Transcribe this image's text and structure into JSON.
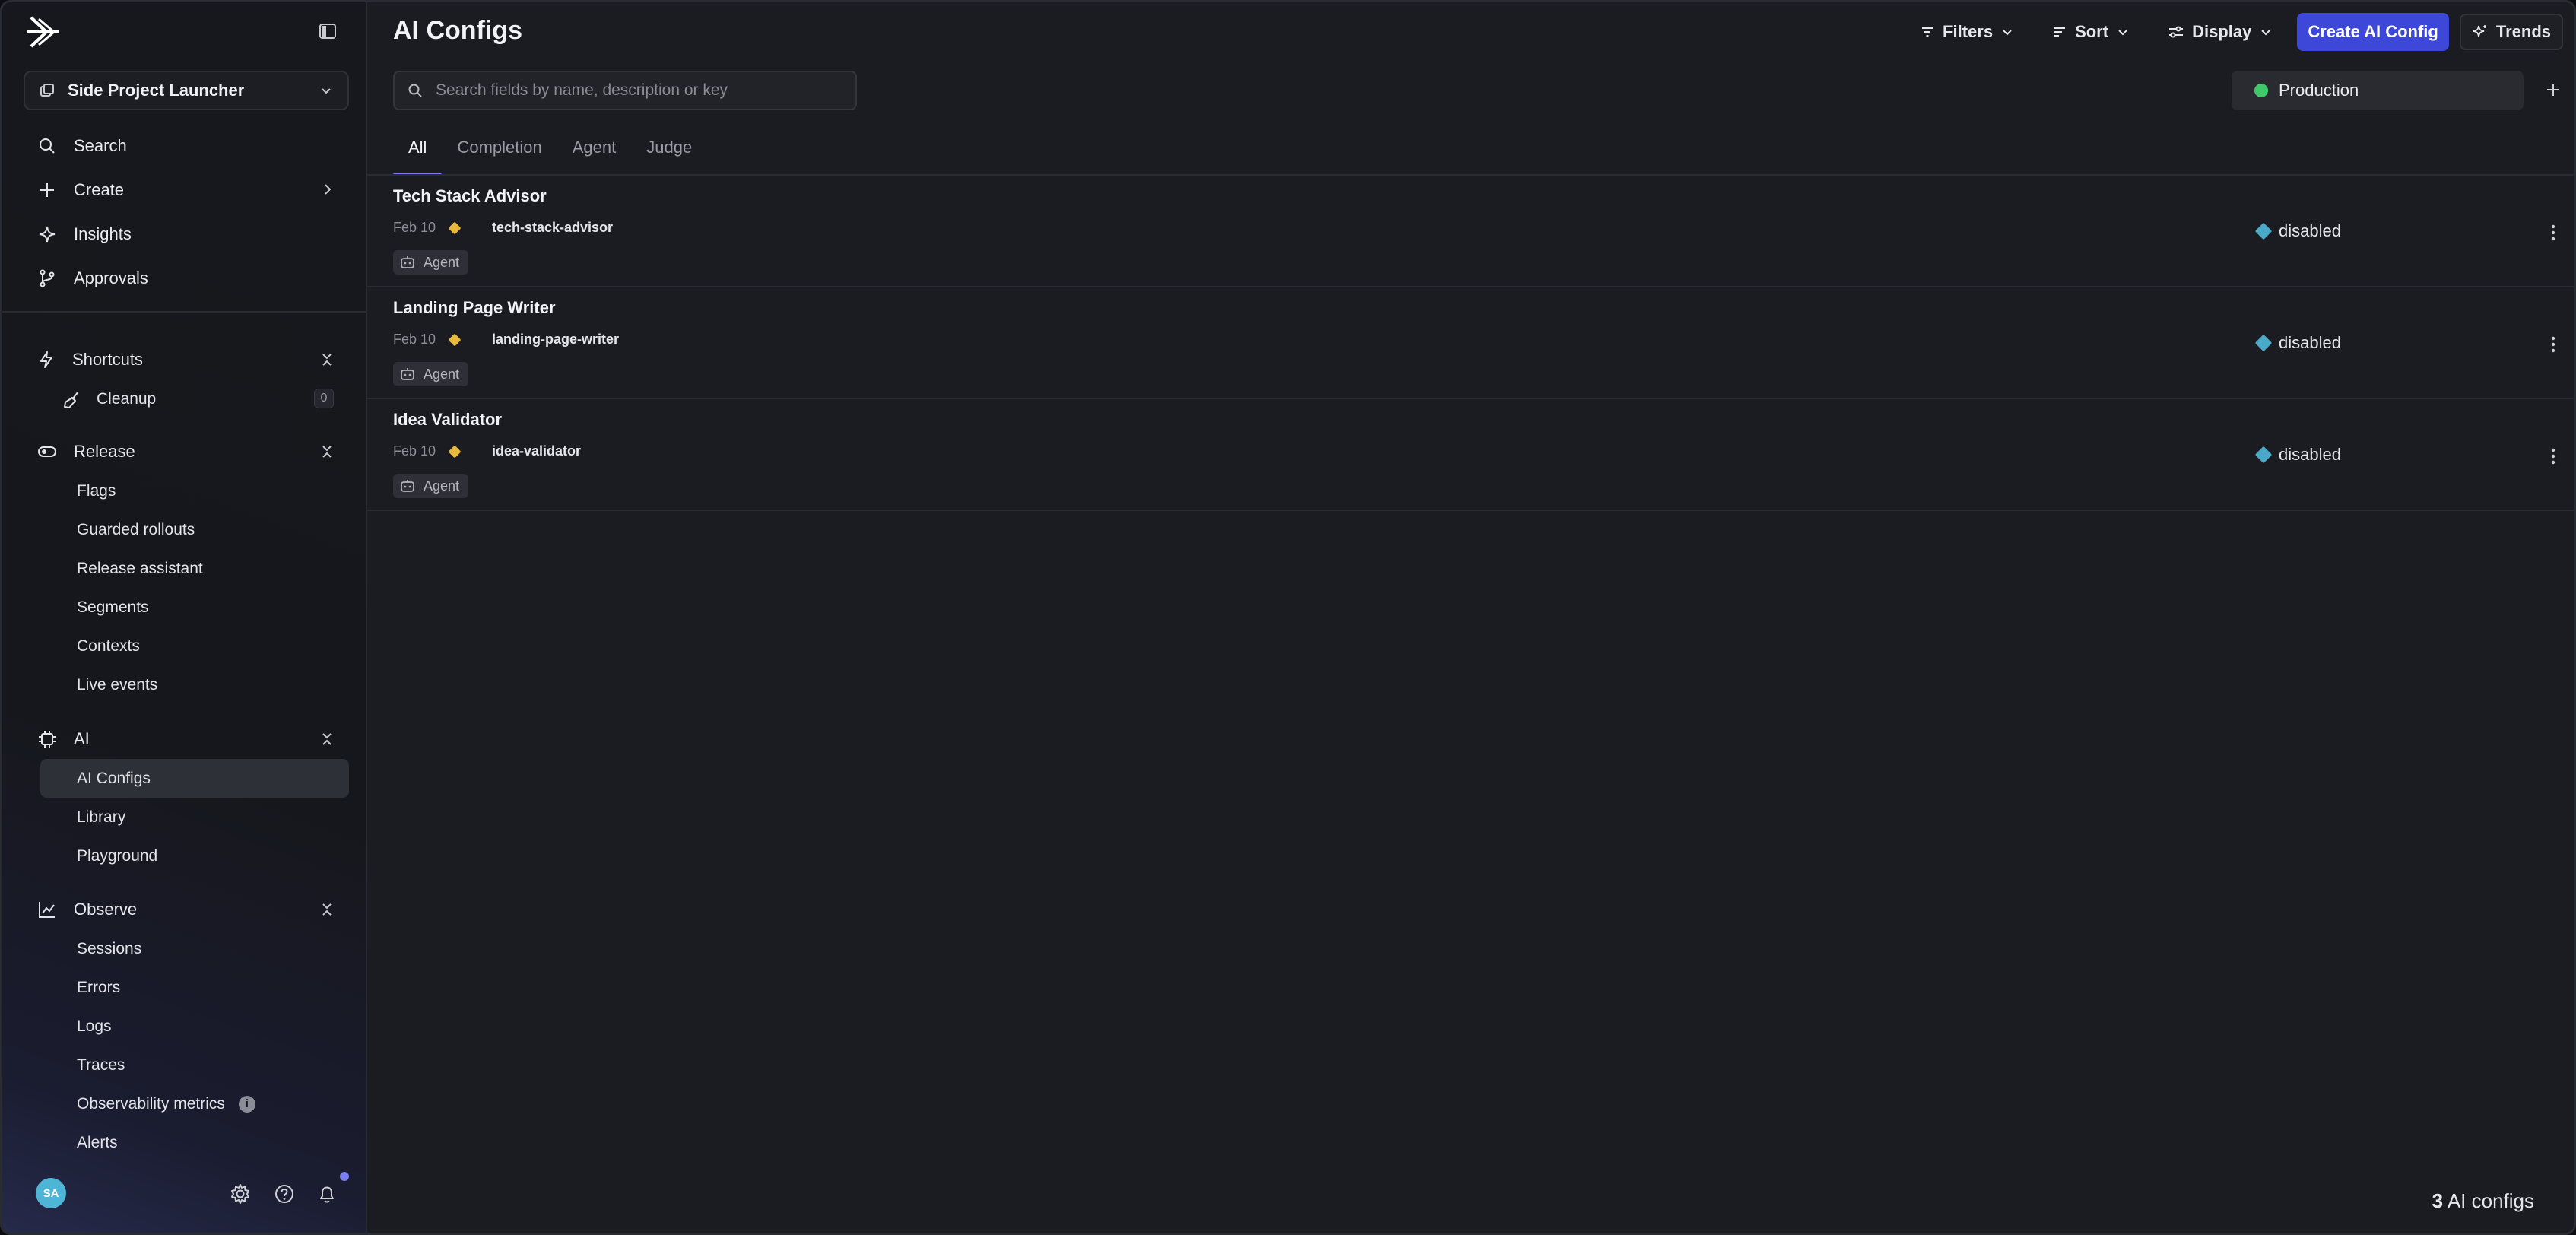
{
  "app": {
    "project_name": "Side Project Launcher"
  },
  "sidebar": {
    "top_items": [
      {
        "label": "Search",
        "icon": "search-icon"
      },
      {
        "label": "Create",
        "icon": "plus-icon"
      },
      {
        "label": "Insights",
        "icon": "sparkle-icon"
      },
      {
        "label": "Approvals",
        "icon": "branch-icon"
      }
    ],
    "shortcuts": {
      "label": "Shortcuts",
      "items": [
        {
          "label": "Cleanup",
          "count": "0"
        }
      ]
    },
    "release": {
      "label": "Release",
      "items": [
        "Flags",
        "Guarded rollouts",
        "Release assistant",
        "Segments",
        "Contexts",
        "Live events"
      ]
    },
    "ai": {
      "label": "AI",
      "items": [
        "AI Configs",
        "Library",
        "Playground"
      ],
      "active": "AI Configs"
    },
    "observe": {
      "label": "Observe",
      "items": [
        "Sessions",
        "Errors",
        "Logs",
        "Traces",
        "Observability metrics",
        "Alerts"
      ]
    },
    "user_initials": "SA"
  },
  "header": {
    "title": "AI Configs",
    "filters_label": "Filters",
    "sort_label": "Sort",
    "display_label": "Display",
    "create_label": "Create AI Config",
    "trends_label": "Trends"
  },
  "search": {
    "placeholder": "Search fields by name, description or key"
  },
  "environment": {
    "label": "Production",
    "color": "#3fc96a"
  },
  "tabs": [
    {
      "label": "All",
      "active": true
    },
    {
      "label": "Completion",
      "active": false
    },
    {
      "label": "Agent",
      "active": false
    },
    {
      "label": "Judge",
      "active": false
    }
  ],
  "configs": [
    {
      "name": "Tech Stack Advisor",
      "date": "Feb 10",
      "key": "tech-stack-advisor",
      "type": "Agent",
      "status": "disabled"
    },
    {
      "name": "Landing Page Writer",
      "date": "Feb 10",
      "key": "landing-page-writer",
      "type": "Agent",
      "status": "disabled"
    },
    {
      "name": "Idea Validator",
      "date": "Feb 10",
      "key": "idea-validator",
      "type": "Agent",
      "status": "disabled"
    }
  ],
  "footer": {
    "count": "3",
    "count_label": "AI configs"
  },
  "colors": {
    "accent": "#3d47d8",
    "status_disabled": "#4aa8c8",
    "flag_yellow": "#e8b93c"
  }
}
